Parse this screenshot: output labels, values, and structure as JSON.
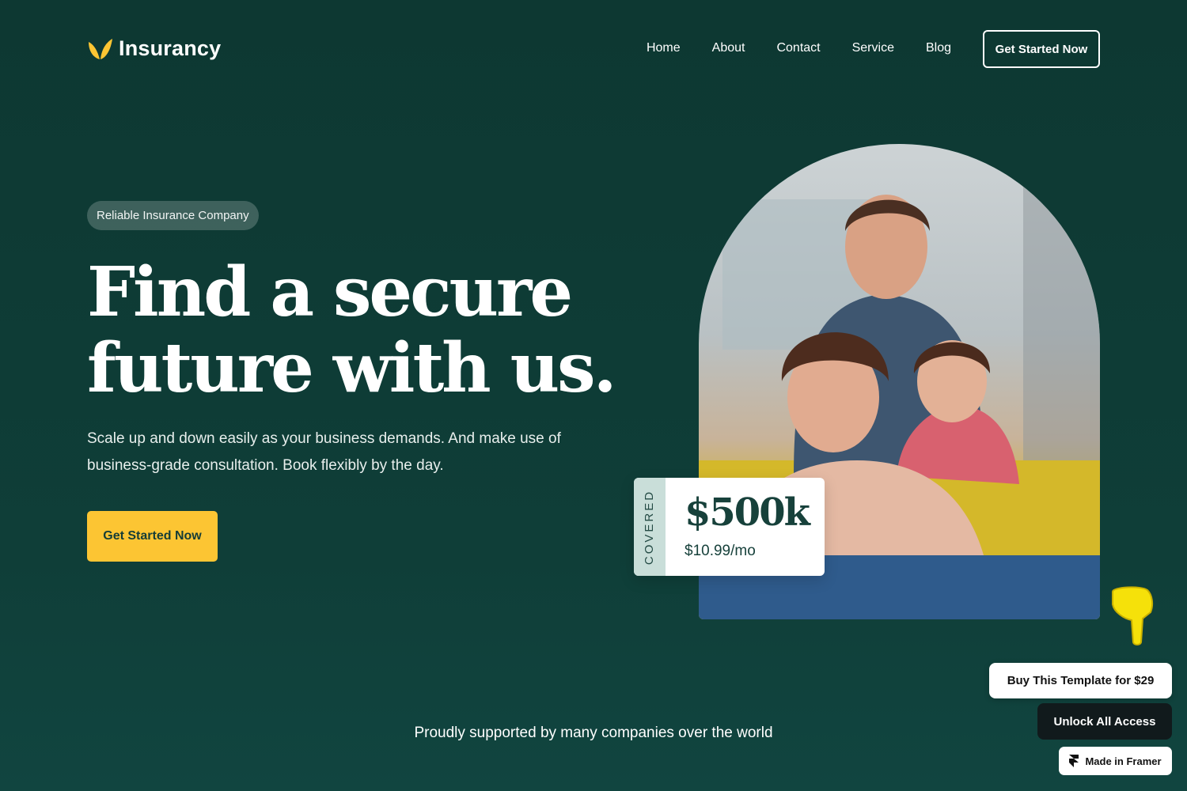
{
  "brand": {
    "name": "Insurancy",
    "logo_icon": "leaf-icon",
    "accent": "#fcc533",
    "background": "#0d3832"
  },
  "nav": {
    "links": [
      "Home",
      "About",
      "Contact",
      "Service",
      "Blog"
    ],
    "cta_label": "Get Started Now"
  },
  "hero": {
    "badge": "Reliable Insurance Company",
    "headline_line1": "Find a secure",
    "headline_line2": "future with us.",
    "subtext": "Scale up and down easily as your business demands. And make use of business-grade consultation. Book flexibly by the day.",
    "cta_label": "Get Started Now"
  },
  "coverage_card": {
    "label": "COVERED",
    "amount": "$500k",
    "price": "$10.99/mo"
  },
  "support_text": "Proudly supported by many companies over the world",
  "template_overlay": {
    "pointer_icon": "pointing-hand-icon",
    "buy_label": "Buy This Template for $29",
    "unlock_label": "Unlock All Access",
    "framer_label": "Made in Framer",
    "framer_icon": "framer-icon"
  }
}
